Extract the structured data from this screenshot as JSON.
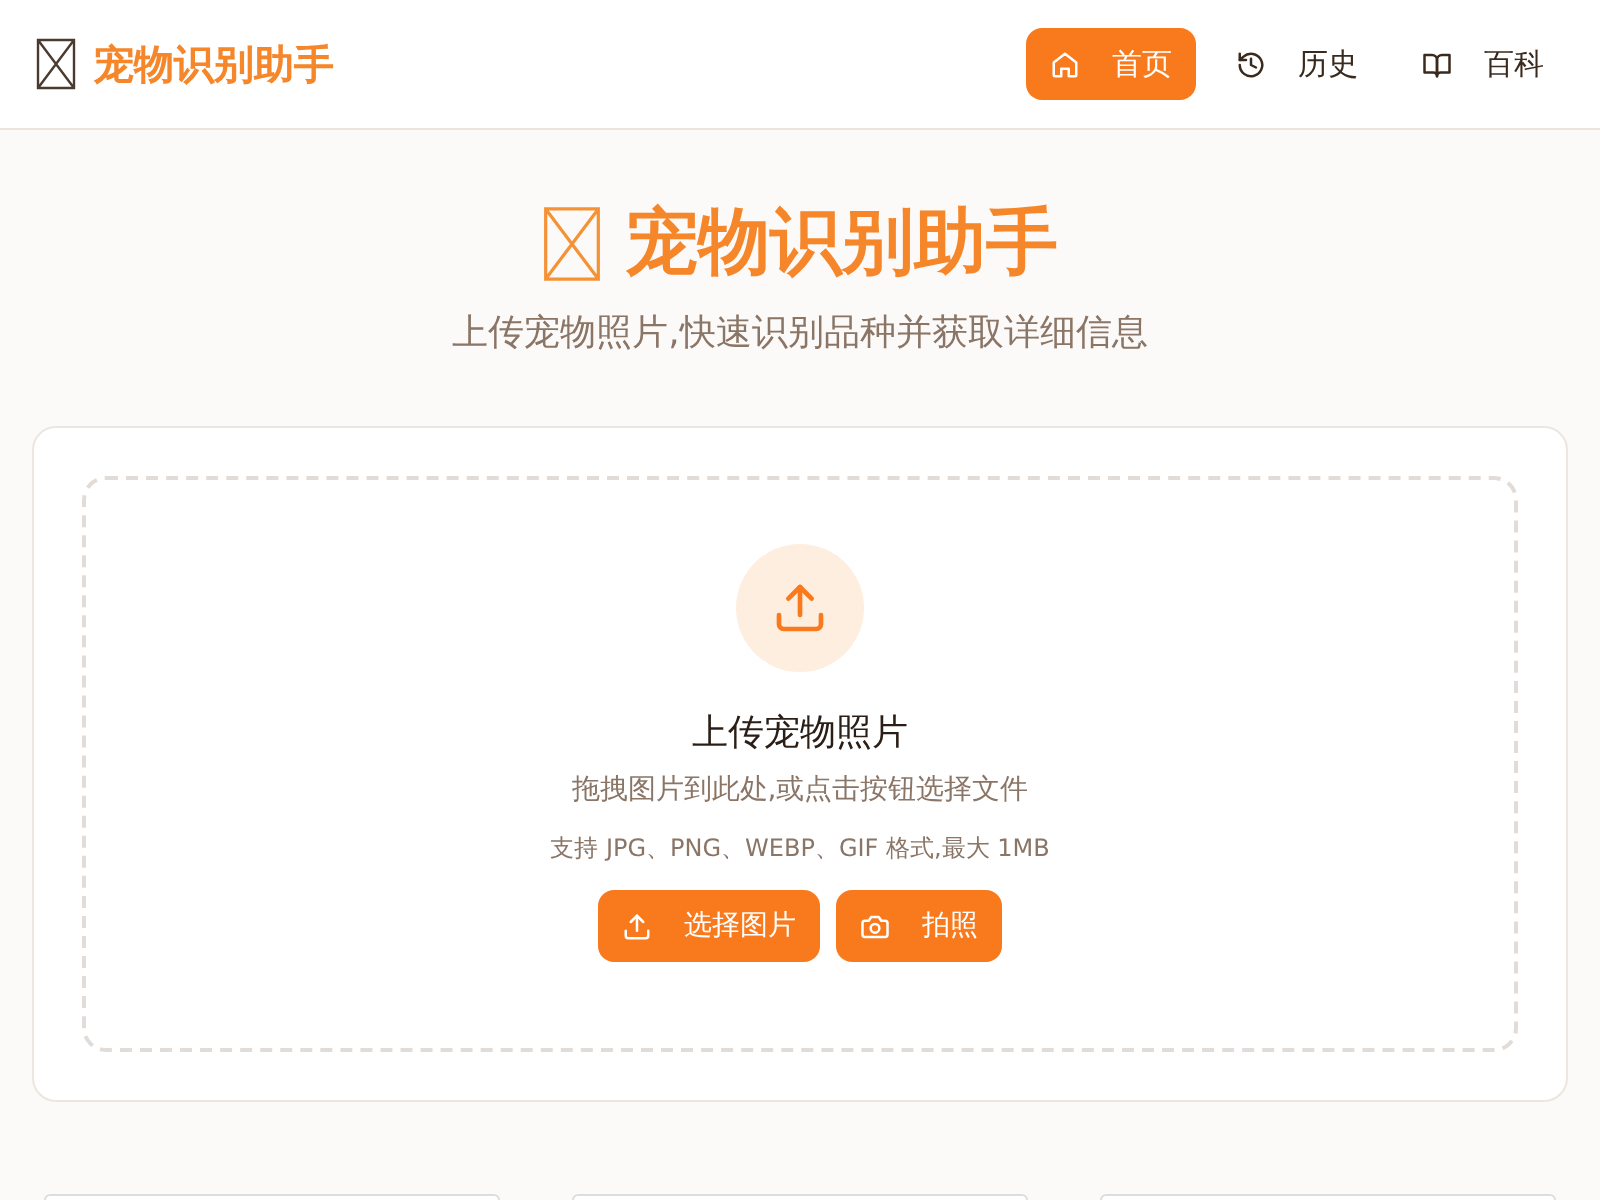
{
  "header": {
    "brand": "宠物识别助手",
    "nav": [
      {
        "label": "首页",
        "kind": "home",
        "selected": true
      },
      {
        "label": "历史",
        "kind": "history",
        "selected": false
      },
      {
        "label": "百科",
        "kind": "book",
        "selected": false
      }
    ]
  },
  "hero": {
    "title": "宠物识别助手",
    "subtitle": "上传宠物照片,快速识别品种并获取详细信息"
  },
  "upload": {
    "title": "上传宠物照片",
    "hint": "拖拽图片到此处,或点击按钮选择文件",
    "formats": "支持 JPG、PNG、WEBP、GIF 格式,最大 1MB",
    "buttons": [
      {
        "label": "选择图片",
        "kind": "upload"
      },
      {
        "label": "拍照",
        "kind": "camera"
      }
    ]
  }
}
